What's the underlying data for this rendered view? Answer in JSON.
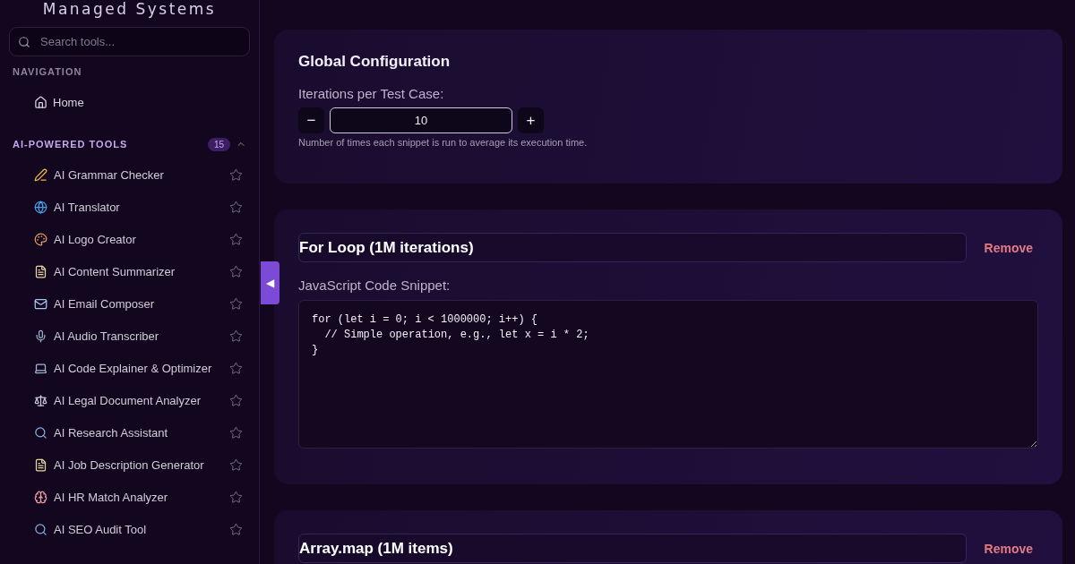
{
  "sidebar": {
    "brand": "Managed Systems",
    "search": {
      "placeholder": "Search tools..."
    },
    "nav_heading": "NAVIGATION",
    "nav_items": [
      {
        "label": "Home",
        "kind": "home"
      }
    ],
    "section": {
      "title": "AI-POWERED TOOLS",
      "count": "15",
      "expanded": true,
      "items": [
        {
          "label": "AI Grammar Checker",
          "kind": "writing",
          "favorite": false
        },
        {
          "label": "AI Translator",
          "kind": "language",
          "favorite": false
        },
        {
          "label": "AI Logo Creator",
          "kind": "design",
          "favorite": false
        },
        {
          "label": "AI Content Summarizer",
          "kind": "document",
          "favorite": false
        },
        {
          "label": "AI Email Composer",
          "kind": "email",
          "favorite": false
        },
        {
          "label": "AI Audio Transcriber",
          "kind": "audio",
          "favorite": false
        },
        {
          "label": "AI Code Explainer & Optimizer",
          "kind": "code",
          "favorite": false
        },
        {
          "label": "AI Legal Document Analyzer",
          "kind": "legal",
          "favorite": false
        },
        {
          "label": "AI Research Assistant",
          "kind": "research",
          "favorite": false
        },
        {
          "label": "AI Job Description Generator",
          "kind": "document",
          "favorite": false
        },
        {
          "label": "AI HR Match Analyzer",
          "kind": "analysis",
          "favorite": false
        },
        {
          "label": "AI SEO Audit Tool",
          "kind": "research",
          "favorite": false
        }
      ]
    }
  },
  "collapse_button": {
    "label": "◀"
  },
  "global_config": {
    "title": "Global Configuration",
    "field_label": "Iterations per Test Case:",
    "value": "10",
    "decrement": "−",
    "increment": "+",
    "hint": "Number of times each snippet is run to average its execution time."
  },
  "test_cases": [
    {
      "name": "For Loop (1M iterations)",
      "remove": "Remove",
      "code_label": "JavaScript Code Snippet:",
      "code": "for (let i = 0; i < 1000000; i++) {\n  // Simple operation, e.g., let x = i * 2;\n}"
    },
    {
      "name": "Array.map (1M items)",
      "remove": "Remove"
    }
  ]
}
